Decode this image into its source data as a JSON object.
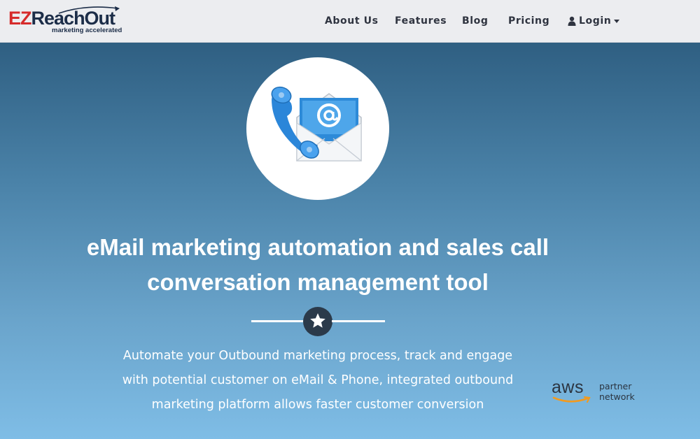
{
  "brand": {
    "logo_prefix": "EZ",
    "logo_suffix": "ReachOut",
    "tagline": "marketing accelerated",
    "prefix_color": "#d62b2b",
    "suffix_color": "#1c2d48"
  },
  "nav": {
    "about": "About Us",
    "features": "Features",
    "blog": "Blog",
    "pricing": "Pricing",
    "login": "Login",
    "login_icon": "user-icon"
  },
  "hero": {
    "image_icon": "phone-email-icon",
    "headline": "eMail marketing automation and sales call conversation management tool",
    "divider_icon": "star-icon",
    "subtext": "Automate your Outbound marketing process, track and engage with potential customer on eMail & Phone, integrated outbound marketing platform allows faster customer conversion",
    "gradient_top": "#2f5f82",
    "gradient_bottom": "#7fbde6"
  },
  "partner": {
    "name": "aws",
    "line1": "partner",
    "line2": "network",
    "smile_color": "#f29a1f"
  }
}
